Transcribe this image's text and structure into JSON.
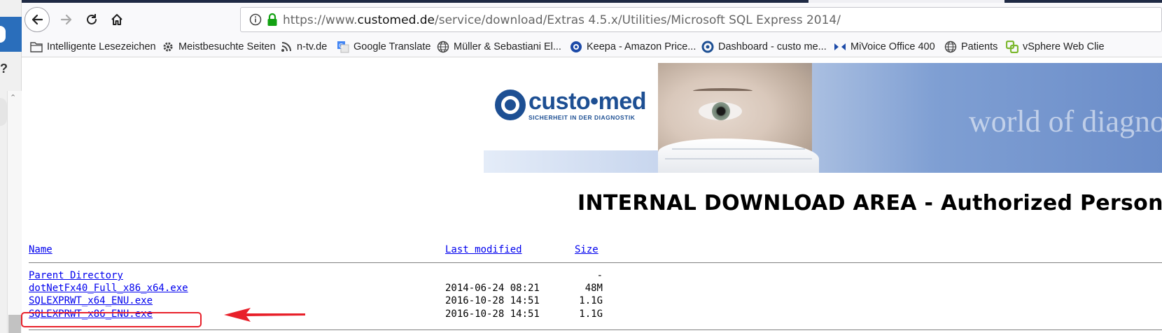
{
  "browser": {
    "url_prefix": "https://www.",
    "url_domain": "customed.de",
    "url_path": "/service/download/Extras 4.5.x/Utilities/Microsoft SQL Express 2014/"
  },
  "bookmarks": [
    {
      "label": "Intelligente Lesezeichen",
      "icon": "folder-icon"
    },
    {
      "label": "Meistbesuchte Seiten",
      "icon": "gear-icon"
    },
    {
      "label": "n-tv.de",
      "icon": "rss-icon"
    },
    {
      "label": "Google Translate",
      "icon": "translate-icon"
    },
    {
      "label": "Müller & Sebastiani El...",
      "icon": "globe-icon"
    },
    {
      "label": "Keepa - Amazon Price...",
      "icon": "keepa-icon"
    },
    {
      "label": "Dashboard - custo me...",
      "icon": "custo-icon"
    },
    {
      "label": "MiVoice Office 400",
      "icon": "mivoice-icon"
    },
    {
      "label": "Patients",
      "icon": "globe-icon"
    },
    {
      "label": "vSphere Web Clie",
      "icon": "vsphere-icon"
    }
  ],
  "left_strip": {
    "question_mark": "?"
  },
  "banner": {
    "logo_name": "custo•med",
    "logo_tagline": "SICHERHEIT IN DER DIAGNOSTIK",
    "slogan": "world of diagnostic"
  },
  "page": {
    "heading": "INTERNAL DOWNLOAD AREA - Authorized Person"
  },
  "listing": {
    "headers": {
      "name": "Name",
      "modified": "Last modified",
      "size": "Size"
    },
    "rows": [
      {
        "name": "Parent Directory",
        "modified": "",
        "size": "-"
      },
      {
        "name": "dotNetFx40_Full_x86_x64.exe",
        "modified": "2014-06-24 08:21",
        "size": "48M"
      },
      {
        "name": "SQLEXPRWT_x64_ENU.exe",
        "modified": "2016-10-28 14:51",
        "size": "1.1G"
      },
      {
        "name": "SQLEXPRWT_x86_ENU.exe",
        "modified": "2016-10-28 14:51",
        "size": "1.1G"
      }
    ]
  },
  "colors": {
    "link": "#0000ee",
    "annotation_red": "#e8202a",
    "brand_blue": "#1d4f93"
  }
}
